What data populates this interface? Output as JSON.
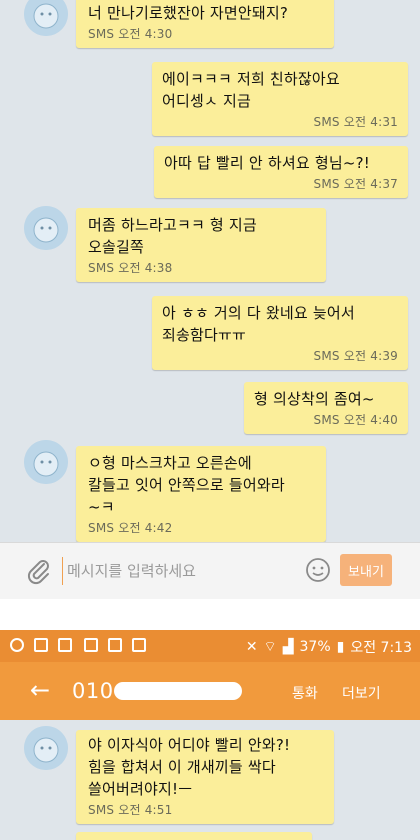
{
  "conversation_top": {
    "messages": [
      {
        "direction": "received",
        "text": "너 만나기로했잔아 자면안돼지?",
        "time": "SMS 오전 4:30"
      },
      {
        "direction": "sent",
        "text": "에이ㅋㅋㅋ 저희 친하잖아요\n어디셍ㅅ 지금",
        "time": "SMS 오전 4:31"
      },
      {
        "direction": "sent",
        "text": "아따 답 빨리 안 하셔요 형님~?!",
        "time": "SMS 오전 4:37"
      },
      {
        "direction": "received",
        "text": "머좀 하느라고ㅋㅋ 형 지금\n오솔길쪽",
        "time": "SMS 오전 4:38"
      },
      {
        "direction": "sent",
        "text": "아 ㅎㅎ 거의 다 왔네요 늦어서\n죄송함다ㅠㅠ",
        "time": "SMS 오전 4:39"
      },
      {
        "direction": "sent",
        "text": "형 의상착의 좀여~",
        "time": "SMS 오전 4:40"
      },
      {
        "direction": "received",
        "text": "ㅇ형 마스크차고 오른손에\n칼들고 잇어 안쪽으로 들어와라\n~ㅋ",
        "time": "SMS 오전 4:42"
      }
    ]
  },
  "composer": {
    "placeholder": "메시지를 입력하세요",
    "send_label": "보내기",
    "attach_icon": "paperclip-icon",
    "emoji_icon": "smiley-icon"
  },
  "second_screen": {
    "status_bar": {
      "battery": "37%",
      "time": "오전 7:13"
    },
    "header": {
      "back_icon": "back-arrow-icon",
      "number_prefix": "010",
      "call_label": "통화",
      "more_label": "더보기"
    },
    "messages": [
      {
        "direction": "received",
        "text": "야 이자식아 어디야 빨리 안와?!\n힘을 합쳐서 이 개새끼들 싹다\n쓸어버려야지!ㅡ",
        "time": "SMS 오전 4:51"
      }
    ]
  },
  "colors": {
    "bubble": "#fbee9a",
    "chat_background": "#dfe5ea",
    "header_orange": "#f19a3d",
    "status_orange": "#ea8d33",
    "send_button": "#f6b27a"
  }
}
